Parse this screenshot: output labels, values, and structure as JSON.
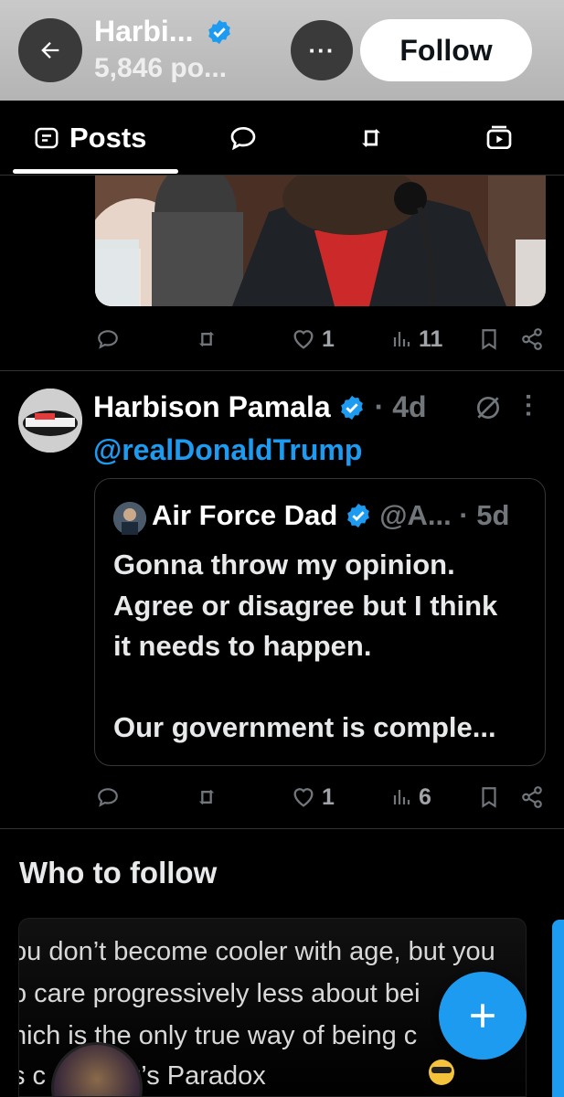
{
  "header": {
    "title": "Harbi...",
    "post_count": "5,846 po...",
    "follow_label": "Follow",
    "more_label": "···"
  },
  "tabs": [
    {
      "label": "Posts",
      "icon": "posts-icon",
      "active": true
    },
    {
      "label": "",
      "icon": "replies-icon"
    },
    {
      "label": "",
      "icon": "reposts-icon"
    },
    {
      "label": "",
      "icon": "media-icon"
    }
  ],
  "post1": {
    "likes": "1",
    "views": "11"
  },
  "post2": {
    "author": "Harbison Pamala",
    "time": "· 4d",
    "text": "@realDonaldTrump",
    "quote": {
      "author": "Air Force Dad",
      "handle": "@A... · 5d",
      "text_lines": [
        "Gonna throw my opinion.",
        "Agree or disagree but I think",
        "it needs to happen.",
        "",
        "Our government is comple..."
      ]
    },
    "likes": "1",
    "views": "6"
  },
  "who_to_follow": {
    "heading": "Who to follow",
    "card_lines": [
      "ou don’t become cooler with age, but you",
      "o care progressively less about bei",
      "hich is the only true way of being c",
      "s c          Geezer’s Paradox"
    ]
  },
  "colors": {
    "accent": "#1d9bf0",
    "background": "#000000",
    "muted": "#71767b",
    "header_bg": "#bdbdbd"
  }
}
